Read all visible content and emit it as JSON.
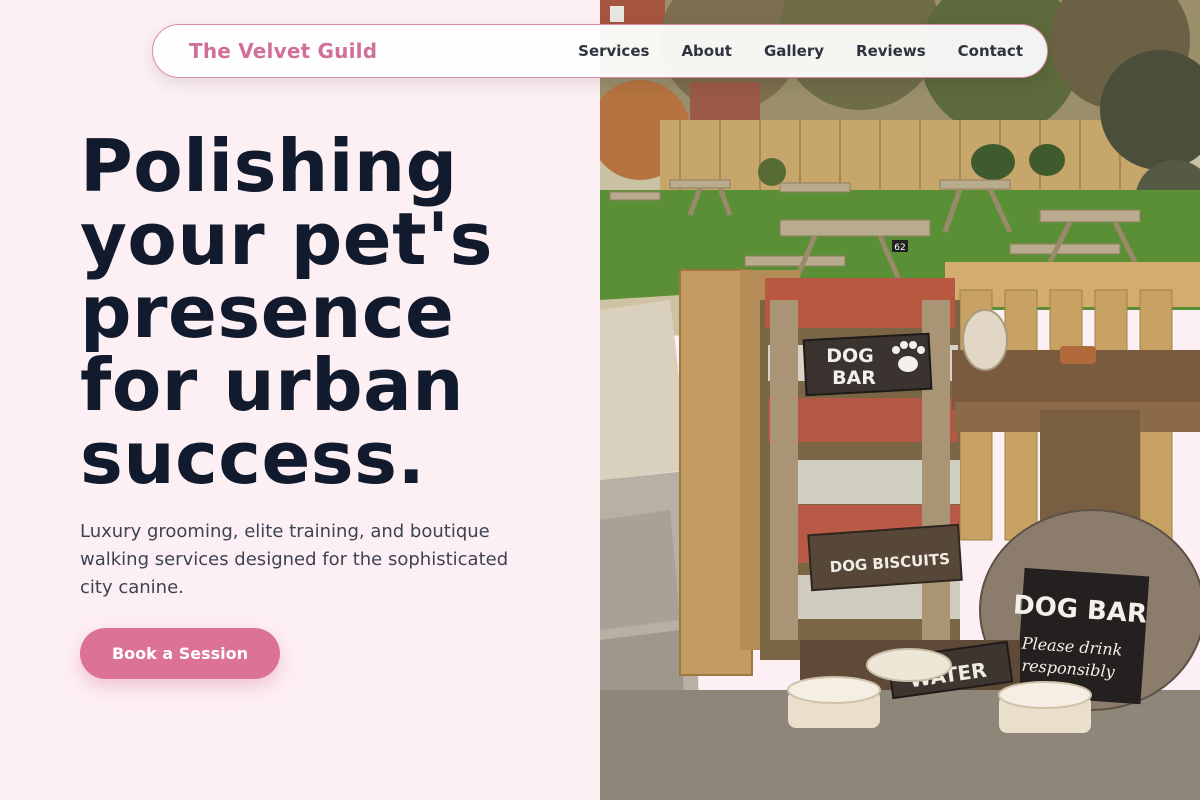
{
  "nav": {
    "brand": "The Velvet Guild",
    "links": [
      "Services",
      "About",
      "Gallery",
      "Reviews",
      "Contact"
    ]
  },
  "hero": {
    "title": "Polishing your pet's presence for urban success.",
    "subtitle": "Luxury grooming, elite training, and boutique walking services designed for the sophisticated city canine.",
    "cta_label": "Book a Session"
  },
  "photo": {
    "signs": {
      "dog_bar_top": [
        "DOG",
        "BAR"
      ],
      "biscuits": "DOG BISCUITS",
      "water": "WATER",
      "board_title": "DOG BAR",
      "board_sub": [
        "Please drink",
        "responsibly"
      ],
      "table_number": "62"
    }
  },
  "colors": {
    "accent": "#dc7397",
    "brand": "#d0709a",
    "background": "#fdf0f4",
    "heading": "#121a2d"
  }
}
